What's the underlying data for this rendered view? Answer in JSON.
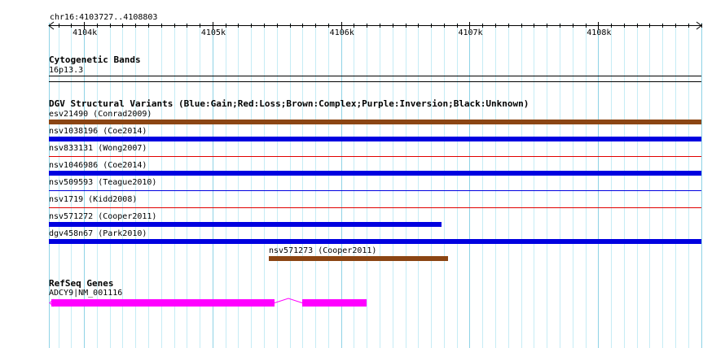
{
  "ruler": {
    "locus": "chr16:4103727..4108803",
    "ticks": [
      {
        "label": "4104k",
        "pos": 4104000
      },
      {
        "label": "4105k",
        "pos": 4105000
      },
      {
        "label": "4106k",
        "pos": 4106000
      },
      {
        "label": "4107k",
        "pos": 4107000
      },
      {
        "label": "4108k",
        "pos": 4108000
      }
    ]
  },
  "region": {
    "start": 4103727,
    "end": 4108803
  },
  "cyto": {
    "title": "Cytogenetic Bands",
    "band": "16p13.3"
  },
  "dgv": {
    "title": "DGV Structural Variants (Blue:Gain;Red:Loss;Brown:Complex;Purple:Inversion;Black:Unknown)",
    "colors": {
      "gain": "#0000e0",
      "loss": "#e00000",
      "complex": "#8b4513"
    },
    "variants": [
      {
        "label": "esv21490 (Conrad2009)",
        "type": "complex",
        "start": 4103727,
        "end": 4108803,
        "style": "thick"
      },
      {
        "label": "nsv1038196 (Coe2014)",
        "type": "gain",
        "start": 4103727,
        "end": 4108803,
        "style": "thick"
      },
      {
        "label": "nsv833131 (Wong2007)",
        "type": "loss",
        "start": 4103727,
        "end": 4108803,
        "style": "thin"
      },
      {
        "label": "nsv1046986 (Coe2014)",
        "type": "gain",
        "start": 4103727,
        "end": 4108803,
        "style": "thick"
      },
      {
        "label": "nsv509593 (Teague2010)",
        "type": "gain",
        "start": 4103727,
        "end": 4108803,
        "style": "thin"
      },
      {
        "label": "nsv1719 (Kidd2008)",
        "type": "loss",
        "start": 4103727,
        "end": 4108803,
        "style": "thin"
      },
      {
        "label": "nsv571272 (Cooper2011)",
        "type": "gain",
        "start": 4103727,
        "end": 4106780,
        "style": "thick"
      },
      {
        "label": "dgv458n67 (Park2010)",
        "type": "gain",
        "start": 4103727,
        "end": 4108803,
        "style": "thick"
      },
      {
        "label": "nsv571273 (Cooper2011)",
        "type": "complex",
        "start": 4105440,
        "end": 4106830,
        "style": "thick"
      }
    ]
  },
  "refseq": {
    "title": "RefSeq Genes",
    "gene": {
      "label": "ADCY9|NM_001116",
      "color": "#ff00ff",
      "strand": "minus",
      "exons": [
        {
          "start": 4103745,
          "end": 4105480
        },
        {
          "start": 4105700,
          "end": 4106200
        }
      ]
    }
  }
}
